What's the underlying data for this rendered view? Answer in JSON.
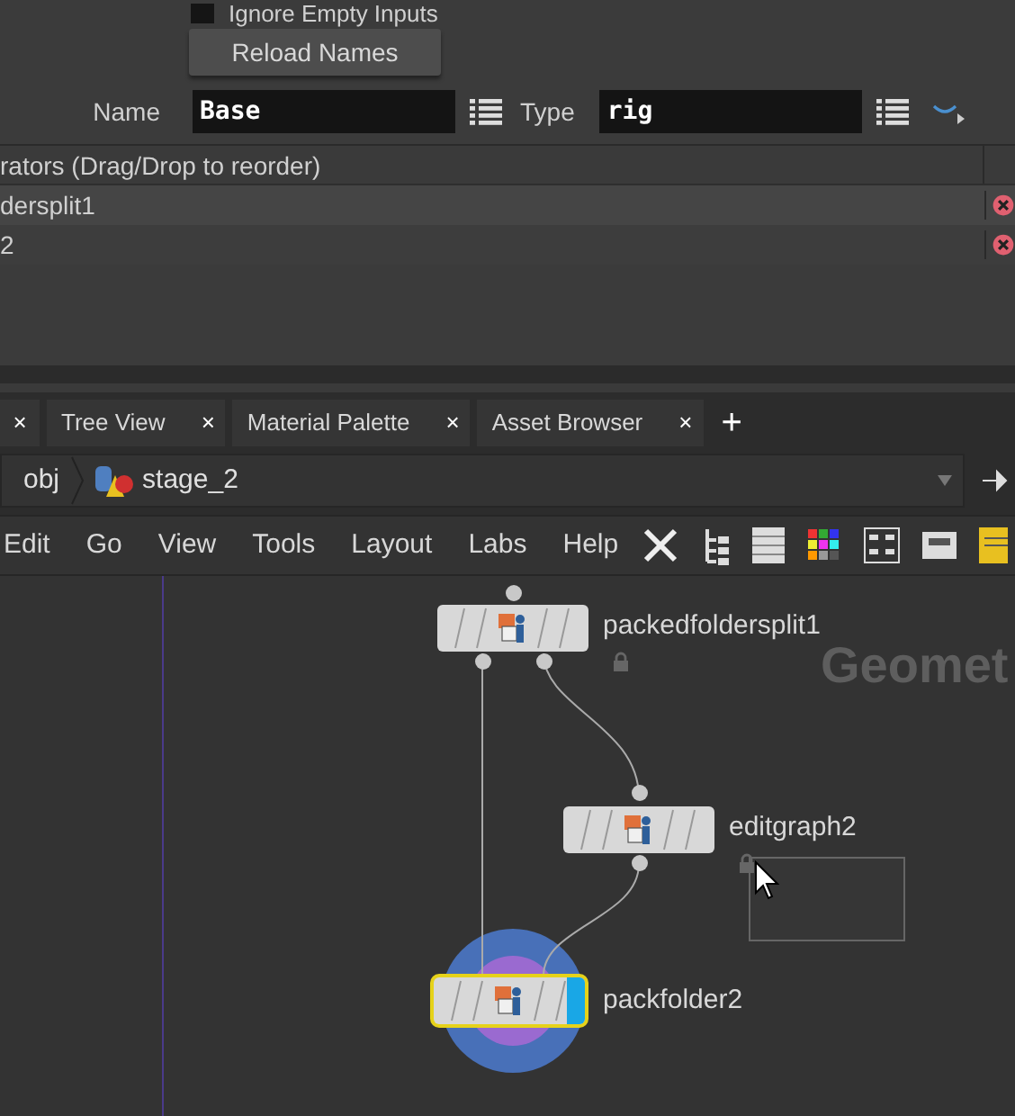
{
  "parameters": {
    "ignore_empty_inputs": {
      "label": "Ignore Empty Inputs",
      "checked": false
    },
    "reload_button": "Reload Names",
    "name_field": {
      "label": "Name",
      "value": "Base"
    },
    "type_field": {
      "label": "Type",
      "value": "rig"
    }
  },
  "operators_list": {
    "header": "rators (Drag/Drop to reorder)",
    "rows": [
      {
        "label": "dersplit1"
      },
      {
        "label": "2"
      }
    ]
  },
  "pane_tabs": {
    "first_close": "×",
    "tabs": [
      {
        "label": "Tree View",
        "close": "×"
      },
      {
        "label": "Material Palette",
        "close": "×"
      },
      {
        "label": "Asset Browser",
        "close": "×"
      }
    ],
    "add": "+"
  },
  "path_bar": {
    "items": [
      "obj",
      "stage_2"
    ]
  },
  "menu": [
    "Edit",
    "Go",
    "View",
    "Tools",
    "Layout",
    "Labs",
    "Help"
  ],
  "network": {
    "type_label": "Geomet",
    "nodes": [
      {
        "name": "packedfoldersplit1",
        "selected": false,
        "locked": true,
        "display": false
      },
      {
        "name": "editgraph2",
        "selected": false,
        "locked": true,
        "display": false
      },
      {
        "name": "packfolder2",
        "selected": true,
        "locked": false,
        "display": true
      }
    ]
  }
}
